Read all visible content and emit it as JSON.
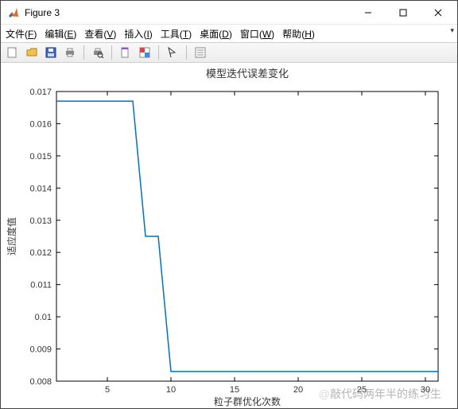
{
  "window": {
    "title": "Figure 3"
  },
  "menus": {
    "file": {
      "label": "文件",
      "mnemonic": "F"
    },
    "edit": {
      "label": "编辑",
      "mnemonic": "E"
    },
    "view": {
      "label": "查看",
      "mnemonic": "V"
    },
    "insert": {
      "label": "插入",
      "mnemonic": "I"
    },
    "tools": {
      "label": "工具",
      "mnemonic": "T"
    },
    "desktop": {
      "label": "桌面",
      "mnemonic": "D"
    },
    "windowm": {
      "label": "窗口",
      "mnemonic": "W"
    },
    "help": {
      "label": "帮助",
      "mnemonic": "H"
    }
  },
  "chart_data": {
    "type": "line",
    "title": "模型迭代误差变化",
    "xlabel": "粒子群优化次数",
    "ylabel": "适应度值",
    "xlim": [
      1,
      31
    ],
    "ylim": [
      0.008,
      0.017
    ],
    "xticks": [
      5,
      10,
      15,
      20,
      25,
      30
    ],
    "yticks": [
      0.008,
      0.009,
      0.01,
      0.011,
      0.012,
      0.013,
      0.014,
      0.015,
      0.016,
      0.017
    ],
    "x": [
      1,
      2,
      3,
      4,
      5,
      6,
      7,
      8,
      9,
      10,
      11,
      12,
      13,
      14,
      15,
      16,
      17,
      18,
      19,
      20,
      21,
      22,
      23,
      24,
      25,
      26,
      27,
      28,
      29,
      30,
      31
    ],
    "y": [
      0.0167,
      0.0167,
      0.0167,
      0.0167,
      0.0167,
      0.0167,
      0.0167,
      0.0125,
      0.0125,
      0.0083,
      0.0083,
      0.0083,
      0.0083,
      0.0083,
      0.0083,
      0.0083,
      0.0083,
      0.0083,
      0.0083,
      0.0083,
      0.0083,
      0.0083,
      0.0083,
      0.0083,
      0.0083,
      0.0083,
      0.0083,
      0.0083,
      0.0083,
      0.0083,
      0.0083
    ],
    "line_color": "#0072bd"
  },
  "watermark": "敲代码两年半的练习生"
}
